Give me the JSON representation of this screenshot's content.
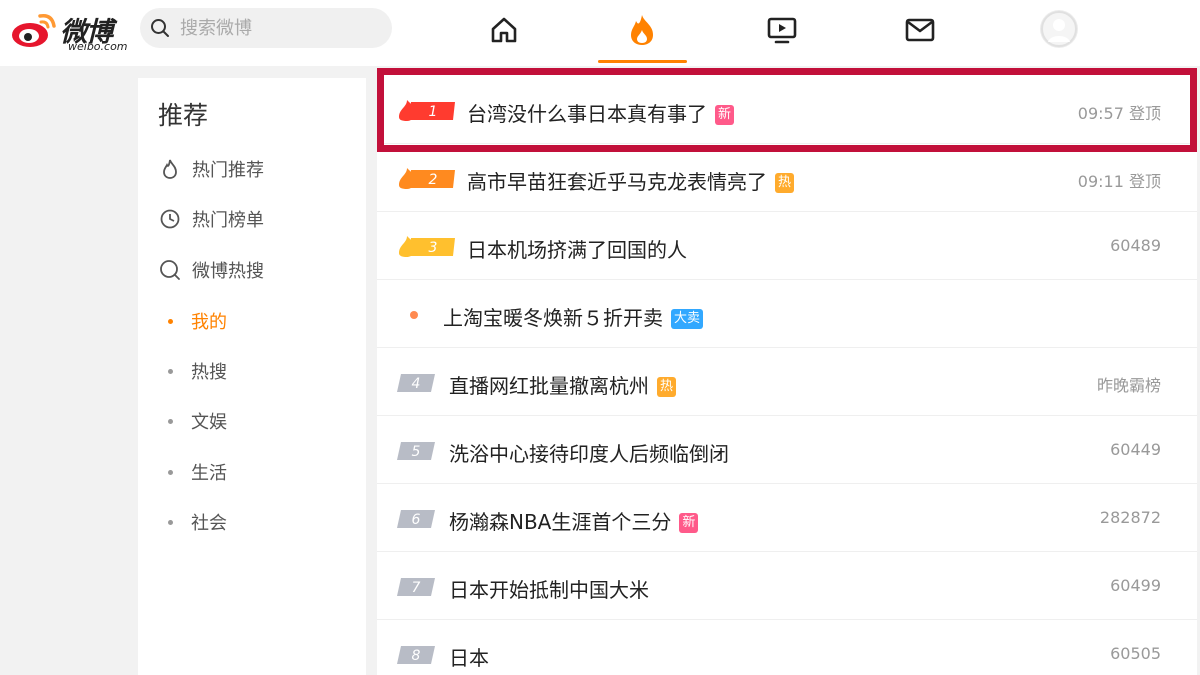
{
  "brand": {
    "name_cn": "微博",
    "name_en": "weibo.com",
    "logo_icon": "weibo-logo-icon"
  },
  "search": {
    "placeholder": "搜索微博",
    "value": ""
  },
  "nav": [
    {
      "name": "home",
      "icon": "home-icon"
    },
    {
      "name": "hot",
      "icon": "fire-icon",
      "active": true
    },
    {
      "name": "video",
      "icon": "video-icon"
    },
    {
      "name": "messages",
      "icon": "mail-icon"
    }
  ],
  "colors": {
    "accent": "#ff8200",
    "highlight": "#c2103a",
    "new_tag": "#ff5a8a",
    "hot_tag": "#ffab2d",
    "sale_tag": "#32a8ff"
  },
  "sidebar": {
    "title": "推荐",
    "items": [
      {
        "label": "热门推荐",
        "icon": "flame-outline-icon"
      },
      {
        "label": "热门榜单",
        "icon": "clock-chart-icon"
      },
      {
        "label": "微博热搜",
        "icon": "search-circle-icon"
      }
    ],
    "subitems": [
      {
        "label": "我的",
        "active": true
      },
      {
        "label": "热搜"
      },
      {
        "label": "文娱"
      },
      {
        "label": "生活"
      },
      {
        "label": "社会"
      }
    ]
  },
  "hot_list": [
    {
      "rank": "1",
      "title": "台湾没什么事日本真有事了",
      "tag": "新",
      "meta": "09:57 登顶"
    },
    {
      "rank": "2",
      "title": "高市早苗狂套近乎马克龙表情亮了",
      "tag": "热",
      "meta": "09:11 登顶"
    },
    {
      "rank": "3",
      "title": "日本机场挤满了回国的人",
      "tag": "",
      "meta": "60489"
    },
    {
      "rank": "",
      "title": "上淘宝暖冬焕新５折开卖",
      "tag": "大卖",
      "meta": ""
    },
    {
      "rank": "4",
      "title": "直播网红批量撤离杭州",
      "tag": "热",
      "meta": "昨晚霸榜"
    },
    {
      "rank": "5",
      "title": "洗浴中心接待印度人后频临倒闭",
      "tag": "",
      "meta": "60449"
    },
    {
      "rank": "6",
      "title": "杨瀚森NBA生涯首个三分",
      "tag": "新",
      "meta": "282872"
    },
    {
      "rank": "7",
      "title": "日本开始抵制中国大米",
      "tag": "",
      "meta": "60499"
    },
    {
      "rank": "8",
      "title": "日本",
      "tag": "",
      "meta": "60505"
    }
  ]
}
